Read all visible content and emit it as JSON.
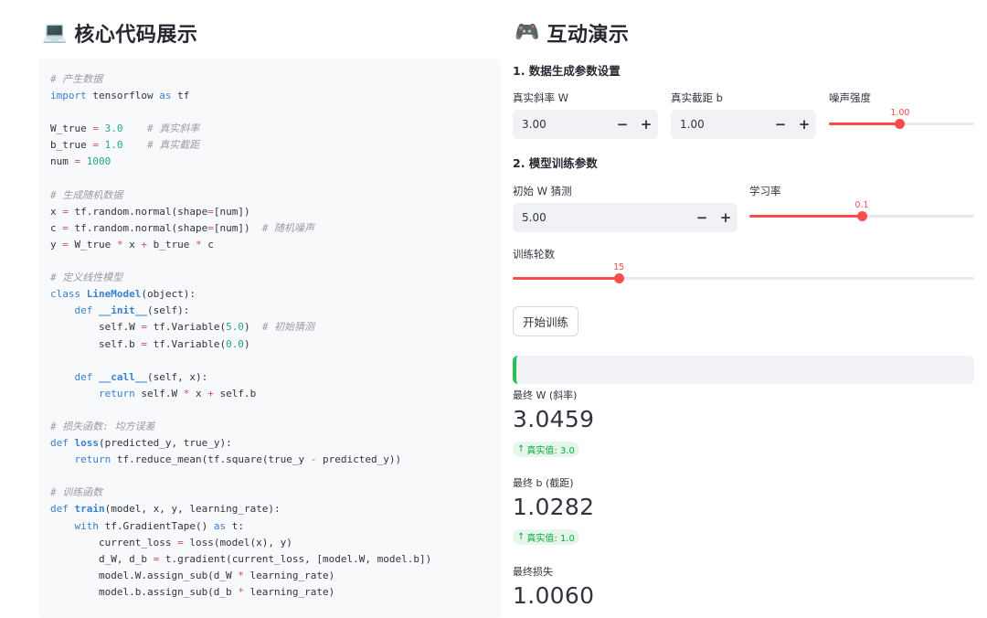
{
  "left": {
    "icon": "computer-icon",
    "title": "核心代码展示",
    "code_lines": [
      [
        {
          "t": "# 产生数据",
          "c": "comment"
        }
      ],
      [
        {
          "t": "import",
          "c": "kw"
        },
        {
          "t": " tensorflow ",
          "c": ""
        },
        {
          "t": "as",
          "c": "kw"
        },
        {
          "t": " tf",
          "c": ""
        }
      ],
      [],
      [
        {
          "t": "W_true ",
          "c": ""
        },
        {
          "t": "=",
          "c": "op"
        },
        {
          "t": " ",
          "c": ""
        },
        {
          "t": "3.0",
          "c": "num"
        },
        {
          "t": "    ",
          "c": ""
        },
        {
          "t": "# 真实斜率",
          "c": "comment"
        }
      ],
      [
        {
          "t": "b_true ",
          "c": ""
        },
        {
          "t": "=",
          "c": "op"
        },
        {
          "t": " ",
          "c": ""
        },
        {
          "t": "1.0",
          "c": "num"
        },
        {
          "t": "    ",
          "c": ""
        },
        {
          "t": "# 真实截距",
          "c": "comment"
        }
      ],
      [
        {
          "t": "num ",
          "c": ""
        },
        {
          "t": "=",
          "c": "op"
        },
        {
          "t": " ",
          "c": ""
        },
        {
          "t": "1000",
          "c": "num"
        }
      ],
      [],
      [
        {
          "t": "# 生成随机数据",
          "c": "comment"
        }
      ],
      [
        {
          "t": "x ",
          "c": ""
        },
        {
          "t": "=",
          "c": "op"
        },
        {
          "t": " tf.random.normal(shape",
          "c": ""
        },
        {
          "t": "=",
          "c": "op"
        },
        {
          "t": "[num])",
          "c": ""
        }
      ],
      [
        {
          "t": "c ",
          "c": ""
        },
        {
          "t": "=",
          "c": "op"
        },
        {
          "t": " tf.random.normal(shape",
          "c": ""
        },
        {
          "t": "=",
          "c": "op"
        },
        {
          "t": "[num])  ",
          "c": ""
        },
        {
          "t": "# 随机噪声",
          "c": "comment"
        }
      ],
      [
        {
          "t": "y ",
          "c": ""
        },
        {
          "t": "=",
          "c": "op"
        },
        {
          "t": " W_true ",
          "c": ""
        },
        {
          "t": "*",
          "c": "op"
        },
        {
          "t": " x ",
          "c": ""
        },
        {
          "t": "+",
          "c": "op"
        },
        {
          "t": " b_true ",
          "c": ""
        },
        {
          "t": "*",
          "c": "op"
        },
        {
          "t": " c",
          "c": ""
        }
      ],
      [],
      [
        {
          "t": "# 定义线性模型",
          "c": "comment"
        }
      ],
      [
        {
          "t": "class",
          "c": "kw"
        },
        {
          "t": " ",
          "c": ""
        },
        {
          "t": "LineModel",
          "c": "fn"
        },
        {
          "t": "(object):",
          "c": ""
        }
      ],
      [
        {
          "t": "    ",
          "c": ""
        },
        {
          "t": "def",
          "c": "kw"
        },
        {
          "t": " ",
          "c": ""
        },
        {
          "t": "__init__",
          "c": "fn"
        },
        {
          "t": "(self):",
          "c": ""
        }
      ],
      [
        {
          "t": "        self.W ",
          "c": ""
        },
        {
          "t": "=",
          "c": "op"
        },
        {
          "t": " tf.Variable(",
          "c": ""
        },
        {
          "t": "5.0",
          "c": "num"
        },
        {
          "t": ")  ",
          "c": ""
        },
        {
          "t": "# 初始猜测",
          "c": "comment"
        }
      ],
      [
        {
          "t": "        self.b ",
          "c": ""
        },
        {
          "t": "=",
          "c": "op"
        },
        {
          "t": " tf.Variable(",
          "c": ""
        },
        {
          "t": "0.0",
          "c": "num"
        },
        {
          "t": ")",
          "c": ""
        }
      ],
      [],
      [
        {
          "t": "    ",
          "c": ""
        },
        {
          "t": "def",
          "c": "kw"
        },
        {
          "t": " ",
          "c": ""
        },
        {
          "t": "__call__",
          "c": "fn"
        },
        {
          "t": "(self, x):",
          "c": ""
        }
      ],
      [
        {
          "t": "        ",
          "c": ""
        },
        {
          "t": "return",
          "c": "kw"
        },
        {
          "t": " self.W ",
          "c": ""
        },
        {
          "t": "*",
          "c": "op"
        },
        {
          "t": " x ",
          "c": ""
        },
        {
          "t": "+",
          "c": "op"
        },
        {
          "t": " self.b",
          "c": ""
        }
      ],
      [],
      [
        {
          "t": "# 损失函数: 均方误差",
          "c": "comment"
        }
      ],
      [
        {
          "t": "def",
          "c": "kw"
        },
        {
          "t": " ",
          "c": ""
        },
        {
          "t": "loss",
          "c": "fn"
        },
        {
          "t": "(predicted_y, true_y):",
          "c": ""
        }
      ],
      [
        {
          "t": "    ",
          "c": ""
        },
        {
          "t": "return",
          "c": "kw"
        },
        {
          "t": " tf.reduce_mean(tf.square(true_y ",
          "c": ""
        },
        {
          "t": "-",
          "c": "op"
        },
        {
          "t": " predicted_y))",
          "c": ""
        }
      ],
      [],
      [
        {
          "t": "# 训练函数",
          "c": "comment"
        }
      ],
      [
        {
          "t": "def",
          "c": "kw"
        },
        {
          "t": " ",
          "c": ""
        },
        {
          "t": "train",
          "c": "fn"
        },
        {
          "t": "(model, x, y, learning_rate):",
          "c": ""
        }
      ],
      [
        {
          "t": "    ",
          "c": ""
        },
        {
          "t": "with",
          "c": "kw"
        },
        {
          "t": " tf.GradientTape() ",
          "c": ""
        },
        {
          "t": "as",
          "c": "kw"
        },
        {
          "t": " t:",
          "c": ""
        }
      ],
      [
        {
          "t": "        current_loss ",
          "c": ""
        },
        {
          "t": "=",
          "c": "op"
        },
        {
          "t": " loss(model(x), y)",
          "c": ""
        }
      ],
      [
        {
          "t": "        d_W, d_b ",
          "c": ""
        },
        {
          "t": "=",
          "c": "op"
        },
        {
          "t": " t.gradient(current_loss, [model.W, model.b])",
          "c": ""
        }
      ],
      [
        {
          "t": "        model.W.assign_sub(d_W ",
          "c": ""
        },
        {
          "t": "*",
          "c": "op"
        },
        {
          "t": " learning_rate)",
          "c": ""
        }
      ],
      [
        {
          "t": "        model.b.assign_sub(d_b ",
          "c": ""
        },
        {
          "t": "*",
          "c": "op"
        },
        {
          "t": " learning_rate)",
          "c": ""
        }
      ]
    ]
  },
  "right": {
    "icon": "game-controller-icon",
    "title": "互动演示",
    "section1": "1. 数据生成参数设置",
    "section2": "2. 模型训练参数",
    "true_w": {
      "label": "真实斜率 W",
      "value": "3.00"
    },
    "true_b": {
      "label": "真实截距 b",
      "value": "1.00"
    },
    "noise": {
      "label": "噪声强度",
      "value": "1.00",
      "fraction": 0.49
    },
    "init_w": {
      "label": "初始 W 猜测",
      "value": "5.00"
    },
    "lr": {
      "label": "学习率",
      "value": "0.1",
      "fraction": 0.5
    },
    "epochs": {
      "label": "训练轮数",
      "value": "15",
      "fraction": 0.23
    },
    "minus": "−",
    "plus": "+",
    "train_button": "开始训练",
    "metrics": [
      {
        "label": "最终 W (斜率)",
        "value": "3.0459",
        "delta": "真实值: 3.0"
      },
      {
        "label": "最终 b (截距)",
        "value": "1.0282",
        "delta": "真实值: 1.0"
      },
      {
        "label": "最终损失",
        "value": "1.0060"
      }
    ],
    "delta_arrow": "↑",
    "accent_color": "#ff4b4b",
    "success_color": "#21c354"
  }
}
